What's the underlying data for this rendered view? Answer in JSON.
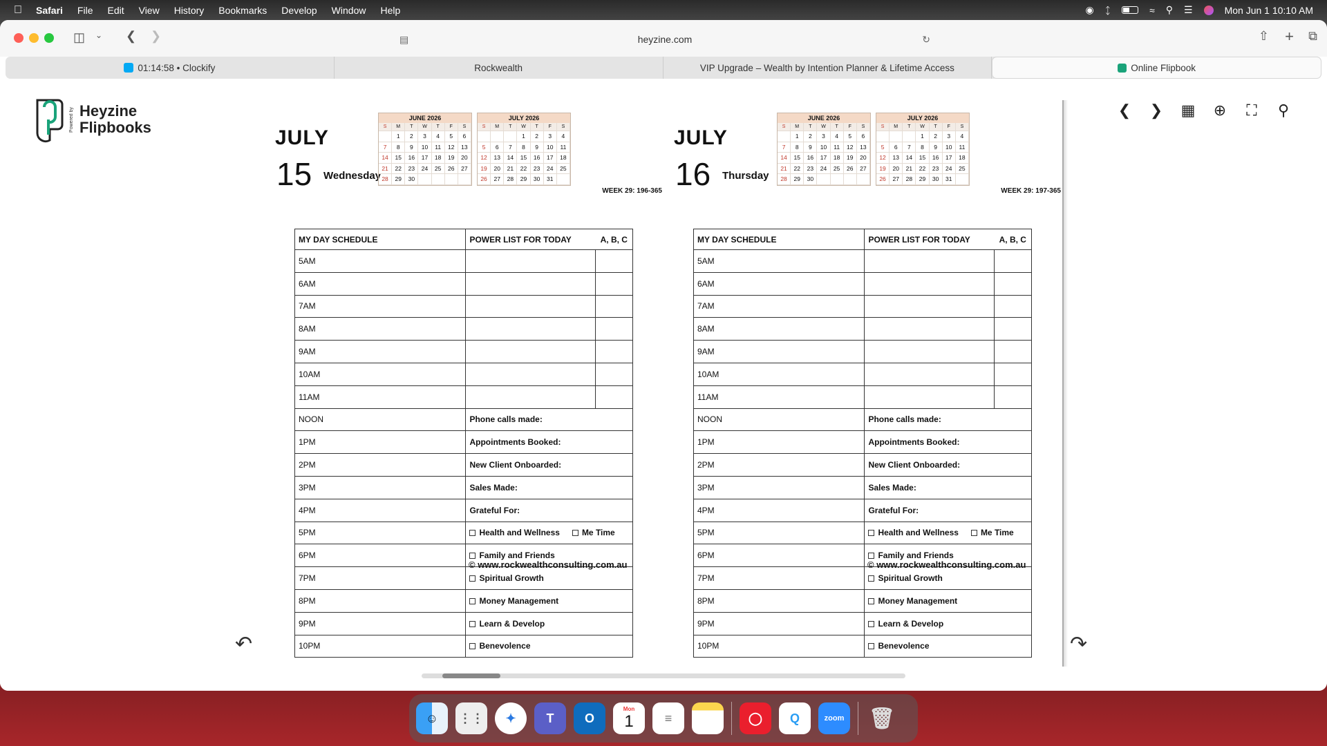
{
  "menubar": {
    "items": [
      "Safari",
      "File",
      "Edit",
      "View",
      "History",
      "Bookmarks",
      "Develop",
      "Window",
      "Help"
    ],
    "datetime": "Mon Jun 1  10:10 AM"
  },
  "browser": {
    "url": "heyzine.com",
    "tabs": [
      {
        "label": "01:14:58 • Clockify"
      },
      {
        "label": "Rockwealth"
      },
      {
        "label": "VIP Upgrade – Wealth by Intention Planner & Lifetime Access"
      },
      {
        "label": "Online Flipbook"
      }
    ]
  },
  "logo": {
    "line1": "Heyzine",
    "line2": "Flipbooks",
    "powered": "Powered by"
  },
  "colors": {
    "accent": "#1aa37a",
    "calendar_header": "#f4d9c6",
    "sunday": "#c0392b"
  },
  "calendars": {
    "june": {
      "title": "JUNE 2026",
      "dow": [
        "S",
        "M",
        "T",
        "W",
        "T",
        "F",
        "S"
      ],
      "days": [
        "",
        "1",
        "2",
        "3",
        "4",
        "5",
        "6",
        "7",
        "8",
        "9",
        "10",
        "11",
        "12",
        "13",
        "14",
        "15",
        "16",
        "17",
        "18",
        "19",
        "20",
        "21",
        "22",
        "23",
        "24",
        "25",
        "26",
        "27",
        "28",
        "29",
        "30",
        "",
        "",
        "",
        ""
      ]
    },
    "july": {
      "title": "JULY 2026",
      "dow": [
        "S",
        "M",
        "T",
        "W",
        "T",
        "F",
        "S"
      ],
      "days": [
        "",
        "",
        "",
        "1",
        "2",
        "3",
        "4",
        "5",
        "6",
        "7",
        "8",
        "9",
        "10",
        "11",
        "12",
        "13",
        "14",
        "15",
        "16",
        "17",
        "18",
        "19",
        "20",
        "21",
        "22",
        "23",
        "24",
        "25",
        "26",
        "27",
        "28",
        "29",
        "30",
        "31",
        ""
      ]
    }
  },
  "pages": [
    {
      "month": "JULY",
      "day": "15",
      "weekday": "Wednesday",
      "week": "WEEK 29: 196-365"
    },
    {
      "month": "JULY",
      "day": "16",
      "weekday": "Thursday",
      "week": "WEEK 29: 197-365"
    }
  ],
  "schedule": {
    "col1": "MY DAY SCHEDULE",
    "col2": "POWER LIST FOR TODAY",
    "col3": "A, B, C",
    "times": [
      "5AM",
      "6AM",
      "7AM",
      "8AM",
      "9AM",
      "10AM",
      "11AM",
      "NOON",
      "1PM",
      "2PM",
      "3PM",
      "4PM",
      "5PM",
      "6PM",
      "7PM",
      "8PM",
      "9PM",
      "10PM"
    ],
    "labels": [
      "Phone calls made:",
      "Appointments Booked:",
      "New Client Onboarded:",
      "Sales Made:",
      "Grateful For:"
    ],
    "checks": {
      "health": "Health and Wellness",
      "me": "Me Time",
      "family": "Family and Friends",
      "spiritual": "Spiritual Growth",
      "money": "Money Management",
      "learn": "Learn & Develop",
      "benev": "Benevolence"
    },
    "copyright": "© www.rockwealthconsulting.com.au"
  },
  "dock": {
    "calendar_month": "Mon",
    "calendar_day": "1",
    "zoom_label": "zoom"
  }
}
